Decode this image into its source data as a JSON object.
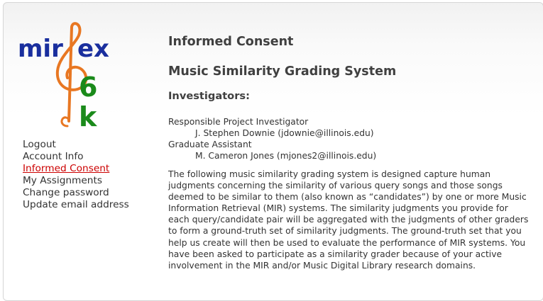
{
  "logo": {
    "text_left": "mir",
    "text_right": "ex",
    "digits": [
      "6",
      "k"
    ]
  },
  "nav": {
    "items": [
      {
        "label": "Logout"
      },
      {
        "label": "Account Info"
      },
      {
        "label": "Informed Consent",
        "active": true
      },
      {
        "label": "My Assignments"
      },
      {
        "label": "Change password"
      },
      {
        "label": "Update email address"
      }
    ]
  },
  "content": {
    "title": "Informed Consent",
    "subtitle": "Music Similarity Grading System",
    "investigators_heading": "Investigators:",
    "roles": [
      {
        "role": "Responsible Project Investigator",
        "person": "J. Stephen Downie (jdownie@illinois.edu)"
      },
      {
        "role": "Graduate Assistant",
        "person": "M. Cameron Jones (mjones2@illinois.edu)"
      }
    ],
    "paragraph": "The following music similarity grading system is designed capture human judgments concerning the similarity of various query songs and those songs deemed to be similar to them (also known as “candidates”) by one or more Music Information Retrieval (MIR) systems. The similarity judgments you provide for each query/candidate pair will be aggregated with the judgments of other graders to form a ground-truth set of similarity judgments. The ground-truth set that you help us create will then be used to evaluate the performance of MIR systems. You have been asked to participate as a similarity grader because of your active involvement in the MIR and/or Music Digital Library research domains."
  },
  "colors": {
    "accent_link": "#cc0000",
    "logo_blue": "#1a2f9e",
    "logo_green": "#1a8a1a",
    "logo_clef": "#e87722"
  }
}
